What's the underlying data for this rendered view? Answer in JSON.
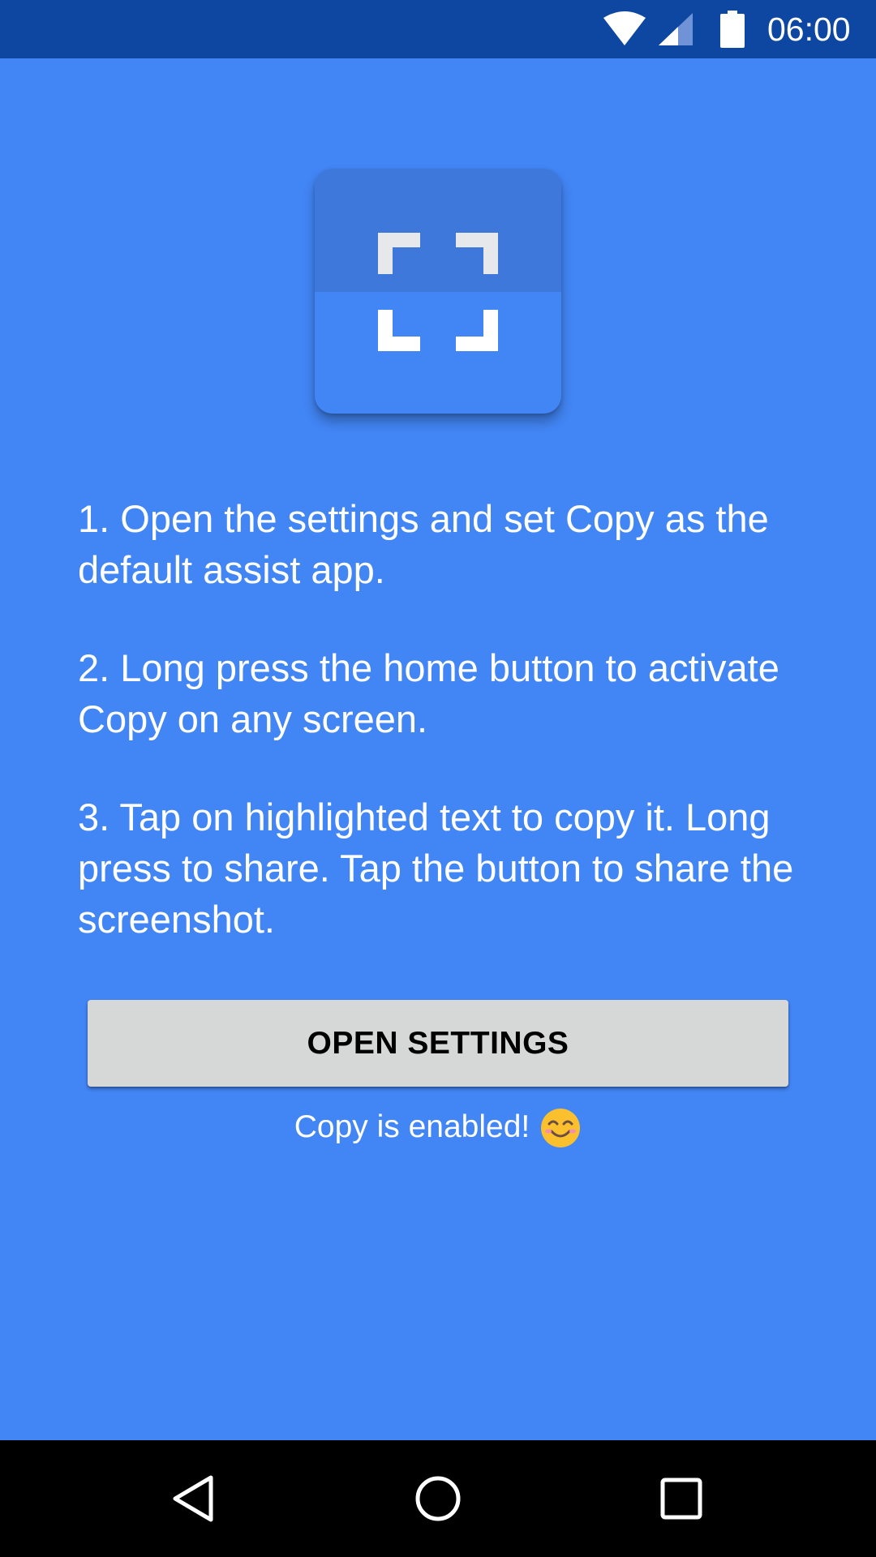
{
  "status_bar": {
    "time": "06:00",
    "icons": [
      "wifi-icon",
      "cellular-signal-icon",
      "battery-icon"
    ]
  },
  "app_icon": {
    "icon": "screen-capture-frame-icon",
    "colors": {
      "top": "#3E78DB",
      "bottom": "#4285F4",
      "brackets": "#FFFFFF"
    }
  },
  "instructions": {
    "steps": [
      "1. Open the settings and set Copy as the default assist app.",
      "2. Long press the home button to activate Copy on any screen.",
      "3. Tap on highlighted text to copy it. Long press to share. Tap the button to share the screenshot."
    ]
  },
  "actions": {
    "open_settings_label": "OPEN SETTINGS"
  },
  "status": {
    "message": "Copy is enabled!",
    "emoji": "smiling-face-emoji"
  },
  "nav_bar": {
    "icons": [
      "back-icon",
      "home-icon",
      "recents-icon"
    ]
  },
  "colors": {
    "background": "#4285F4",
    "status_bar": "#0D47A1",
    "button": "#D6D7D7",
    "nav_bar": "#000000"
  }
}
